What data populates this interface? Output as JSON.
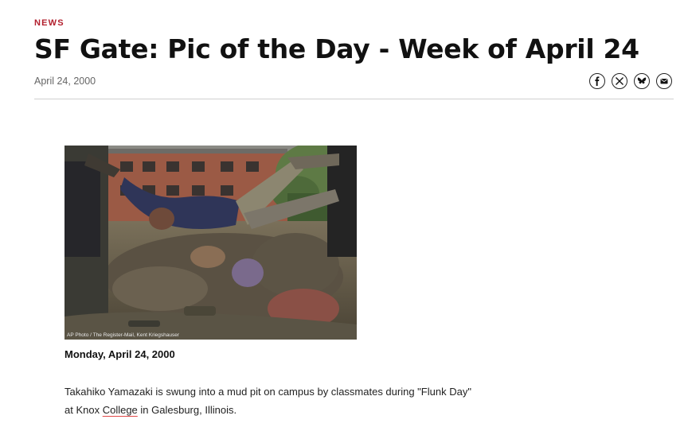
{
  "article": {
    "category": "NEWS",
    "title": "SF Gate: Pic of the Day - Week of April 24",
    "date": "April 24, 2000"
  },
  "share": [
    {
      "icon": "facebook-icon"
    },
    {
      "icon": "x-icon"
    },
    {
      "icon": "bluesky-icon"
    },
    {
      "icon": "email-icon"
    }
  ],
  "photo": {
    "credit": "AP Photo / The Register-Mail, Kent Kriegshauser"
  },
  "caption": {
    "date": "Monday, April 24, 2000",
    "text_before": "Takahiko Yamazaki is swung into a mud pit on campus by classmates during \"Flunk Day\" at Knox ",
    "link": "College",
    "text_after": " in Galesburg, Illinois."
  },
  "colors": {
    "accent": "#b21f2d"
  }
}
